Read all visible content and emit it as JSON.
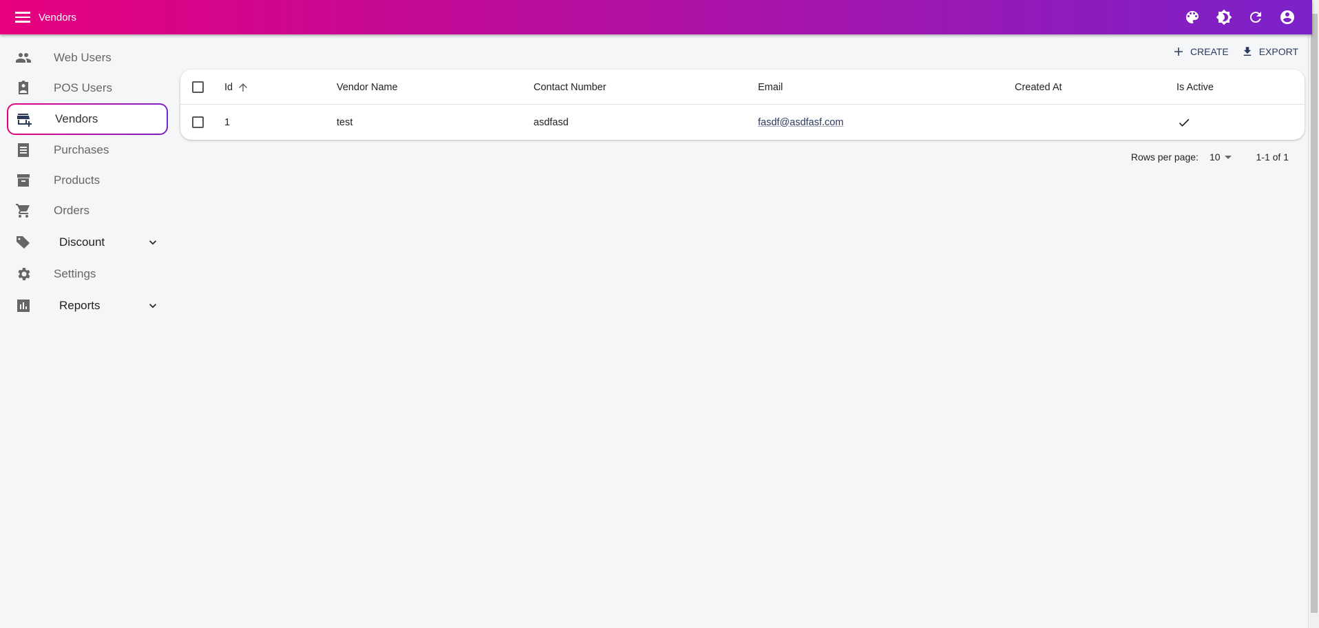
{
  "appbar": {
    "title": "Vendors",
    "icons": [
      "palette-icon",
      "brightness-icon",
      "refresh-icon",
      "account-icon"
    ]
  },
  "sidebar": {
    "items": [
      {
        "label": "Web Users",
        "icon": "people-icon"
      },
      {
        "label": "POS Users",
        "icon": "badge-icon"
      },
      {
        "label": "Vendors",
        "icon": "add-business-icon",
        "active": true
      },
      {
        "label": "Purchases",
        "icon": "receipt-icon"
      },
      {
        "label": "Products",
        "icon": "inventory-icon"
      },
      {
        "label": "Orders",
        "icon": "cart-icon"
      },
      {
        "label": "Discount",
        "icon": "tag-icon",
        "expandable": true
      },
      {
        "label": "Settings",
        "icon": "gear-icon"
      },
      {
        "label": "Reports",
        "icon": "chart-icon",
        "expandable": true
      }
    ]
  },
  "toolbar": {
    "create": "CREATE",
    "export": "EXPORT"
  },
  "table": {
    "columns": [
      "Id",
      "Vendor Name",
      "Contact Number",
      "Email",
      "Created At",
      "Is Active"
    ],
    "sort": {
      "column": "Id",
      "direction": "asc"
    },
    "rows": [
      {
        "id": "1",
        "vendor_name": "test",
        "contact_number": "asdfasd",
        "email": "fasdf@asdfasf.com",
        "created_at": "",
        "is_active": true
      }
    ]
  },
  "pagination": {
    "rows_per_page_label": "Rows per page:",
    "rows_per_page": "10",
    "range": "1-1 of 1"
  },
  "colors": {
    "gradient_start": "#e6007e",
    "gradient_end": "#7b22c9",
    "background": "#f5f6f8"
  }
}
